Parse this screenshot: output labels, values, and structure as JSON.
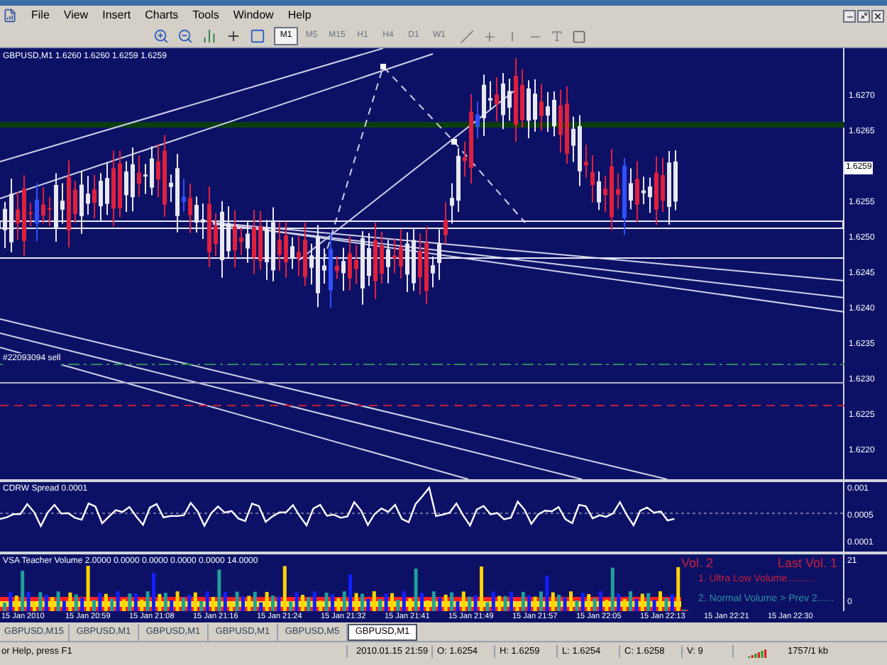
{
  "menu": [
    "File",
    "View",
    "Insert",
    "Charts",
    "Tools",
    "Window",
    "Help"
  ],
  "timeframes": [
    {
      "label": "M1",
      "selected": true
    },
    {
      "label": "M5",
      "selected": false
    },
    {
      "label": "M15",
      "selected": false
    },
    {
      "label": "H1",
      "selected": false
    },
    {
      "label": "H4",
      "selected": false
    },
    {
      "label": "D1",
      "selected": false
    },
    {
      "label": "W1",
      "selected": false
    }
  ],
  "chart": {
    "symbol_info": "GBPUSD,M1  1.6260 1.6260 1.6259 1.6259",
    "order_label": "#22093094 sell",
    "price_labels": [
      {
        "text": "1.6270",
        "kind": "tick"
      },
      {
        "text": "1.6265",
        "kind": "tick"
      },
      {
        "text": "1.6259",
        "kind": "current"
      },
      {
        "text": "1.6255",
        "kind": "tick"
      },
      {
        "text": "1.6250",
        "kind": "tick"
      },
      {
        "text": "1.6245",
        "kind": "tick"
      },
      {
        "text": "1.6240",
        "kind": "tick"
      },
      {
        "text": "1.6235",
        "kind": "tick"
      },
      {
        "text": "1.6230",
        "kind": "tick"
      },
      {
        "text": "1.6225",
        "kind": "tick"
      },
      {
        "text": "1.6220",
        "kind": "tick"
      }
    ]
  },
  "spread_panel": {
    "title": "CDRW Spread 0.0001",
    "axis": [
      "0.001",
      "0.0005",
      "0.0001"
    ]
  },
  "volume_panel": {
    "title": "VSA Teacher Volume 2.0000 0.0000 0.0000 0.0000 0.0000 14.0000",
    "axis": [
      "21",
      "0"
    ],
    "vol": "Vol. 2",
    "last_vol": "Last Vol. 1",
    "legend": [
      {
        "text": "1. Ultra Low Volume..........",
        "color": "#c8203c"
      },
      {
        "text": "2. Normal Volume > Prev 2......",
        "color": "#2a8fa0"
      }
    ]
  },
  "time_axis": [
    "15 Jan 2010",
    "15 Jan 20:59",
    "15 Jan 21:08",
    "15 Jan 21:16",
    "15 Jan 21:24",
    "15 Jan 21:32",
    "15 Jan 21:41",
    "15 Jan 21:49",
    "15 Jan 21:57",
    "15 Jan 22:05",
    "15 Jan 22:13",
    "15 Jan 22:21",
    "15 Jan 22:30"
  ],
  "tabs": [
    {
      "label": "GBPUSD,M15",
      "selected": false
    },
    {
      "label": "GBPUSD,M1",
      "selected": false
    },
    {
      "label": "GBPUSD,M1",
      "selected": false
    },
    {
      "label": "GBPUSD,M1",
      "selected": false
    },
    {
      "label": "GBPUSD,M5",
      "selected": false
    },
    {
      "label": "GBPUSD,M1",
      "selected": true
    }
  ],
  "status_bar": {
    "help": "or Help, press F1",
    "datetime": "2010.01.15 21:59",
    "open": "O: 1.6254",
    "high": "H: 1.6259",
    "low": "L: 1.6254",
    "close": "C: 1.6258",
    "volume": "V: 9",
    "traffic": "1757/1 kb"
  }
}
